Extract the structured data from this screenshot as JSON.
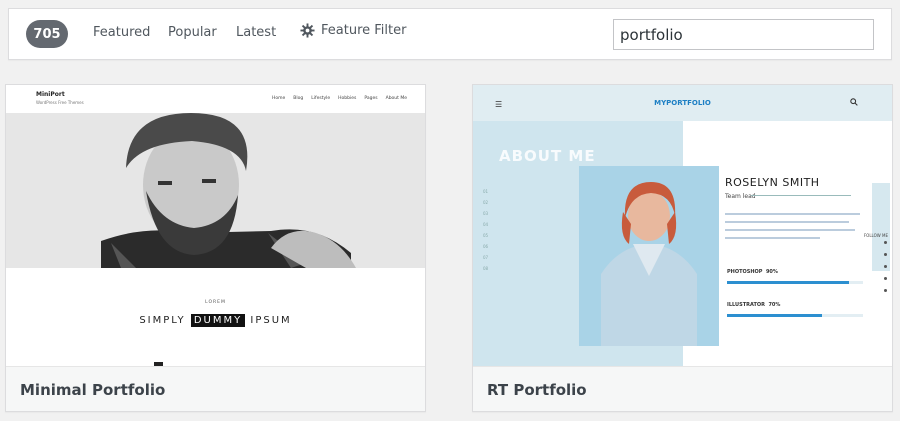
{
  "filter_bar": {
    "count": "705",
    "nav": {
      "featured": "Featured",
      "popular": "Popular",
      "latest": "Latest",
      "feature_filter": "Feature Filter"
    },
    "search": {
      "value": "portfolio"
    }
  },
  "themes": [
    {
      "name": "Minimal Portfolio",
      "preview": {
        "logo": "MiniPort",
        "tagline": "WordPress Free Themes",
        "menu": [
          "Home",
          "Blog",
          "Lifestyle",
          "Hobbies",
          "Pages",
          "About Me"
        ],
        "lorem": "LOREM",
        "title_a": "SIMPLY",
        "title_highlight": "DUMMY",
        "title_b": "IPSUM"
      }
    },
    {
      "name": "RT Portfolio",
      "preview": {
        "logo": "MYPORTFOLIO",
        "heading": "ABOUT ME",
        "person_name": "ROSELYN SMITH",
        "role": "Team lead",
        "years": [
          "01",
          "02",
          "03",
          "04",
          "05",
          "06",
          "07",
          "08"
        ],
        "skills": [
          {
            "label": "PHOTOSHOP",
            "value": "90%",
            "fraction": 0.9
          },
          {
            "label": "ILLUSTRATOR",
            "value": "70%",
            "fraction": 0.7
          }
        ],
        "follow": "FOLLOW ME"
      }
    }
  ],
  "colors": {
    "count_badge": "#646970",
    "accent_blue": "#2c8fd0"
  }
}
